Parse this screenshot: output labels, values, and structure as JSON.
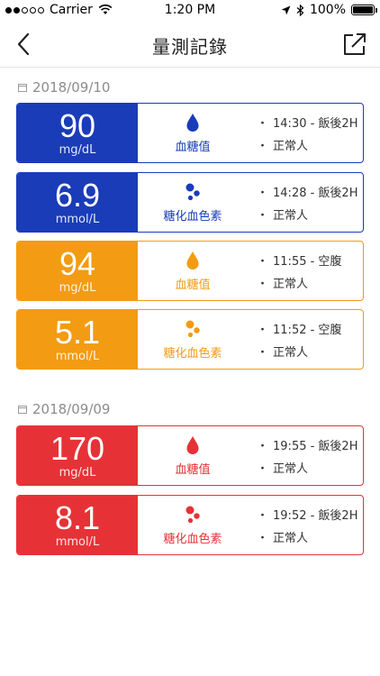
{
  "status_bar": {
    "carrier": "Carrier",
    "time": "1:20 PM",
    "battery": "100%",
    "battery_level": 1.0
  },
  "nav": {
    "title": "量測記錄"
  },
  "colors": {
    "blue": "#1a3cb8",
    "orange": "#f39b13",
    "red": "#e63237"
  },
  "groups": [
    {
      "date": "2018/09/10",
      "records": [
        {
          "value": "90",
          "unit": "mg/dL",
          "type": "血糖值",
          "icon": "blood-drop-icon",
          "color": "blue",
          "time_note": "14:30 - 飯後2H",
          "status": "正常人"
        },
        {
          "value": "6.9",
          "unit": "mmol/L",
          "type": "糖化血色素",
          "icon": "hemoglobin-dots-icon",
          "color": "blue",
          "time_note": "14:28 - 飯後2H",
          "status": "正常人"
        },
        {
          "value": "94",
          "unit": "mg/dL",
          "type": "血糖值",
          "icon": "blood-drop-icon",
          "color": "orange",
          "time_note": "11:55 - 空腹",
          "status": "正常人"
        },
        {
          "value": "5.1",
          "unit": "mmol/L",
          "type": "糖化血色素",
          "icon": "hemoglobin-dots-icon",
          "color": "orange",
          "time_note": "11:52 - 空腹",
          "status": "正常人"
        }
      ]
    },
    {
      "date": "2018/09/09",
      "records": [
        {
          "value": "170",
          "unit": "mg/dL",
          "type": "血糖值",
          "icon": "blood-drop-icon",
          "color": "red",
          "time_note": "19:55 - 飯後2H",
          "status": "正常人"
        },
        {
          "value": "8.1",
          "unit": "mmol/L",
          "type": "糖化血色素",
          "icon": "hemoglobin-dots-icon",
          "color": "red",
          "time_note": "19:52 - 飯後2H",
          "status": "正常人"
        }
      ]
    }
  ],
  "bullet": "・"
}
